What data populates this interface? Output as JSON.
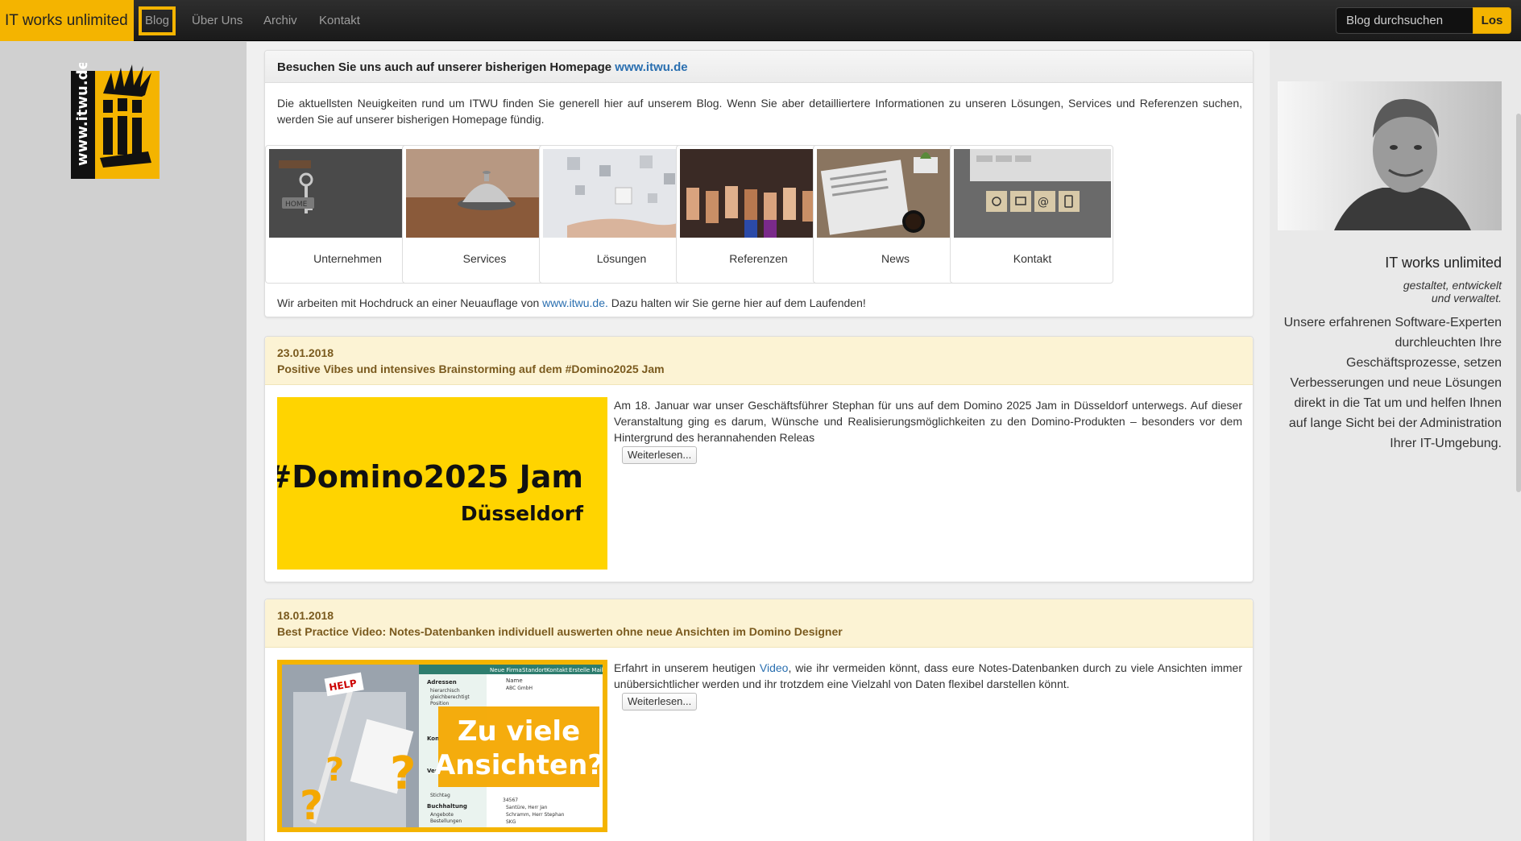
{
  "navbar": {
    "brand": "IT works unlimited",
    "items": [
      {
        "label": "Blog",
        "active": true
      },
      {
        "label": "Über Uns"
      },
      {
        "label": "Archiv"
      },
      {
        "label": "Kontakt"
      }
    ],
    "search_placeholder": "Blog durchsuchen",
    "search_button": "Los"
  },
  "logo": {
    "text": "www.itwu.de",
    "icon": "itwu-logo"
  },
  "intro": {
    "heading_prefix": "Besuchen Sie uns auch auf unserer bisherigen Homepage",
    "heading_link": "www.itwu.de",
    "text": "Die aktuellsten Neuigkeiten rund um ITWU finden Sie generell hier auf unserem Blog. Wenn Sie aber detailliertere Informationen zu unseren Lösungen, Services und Referenzen suchen, werden Sie auf unserer bisherigen Homepage fündig.",
    "tiles": [
      {
        "label": "Unternehmen",
        "icon": "home-key-image"
      },
      {
        "label": "Services",
        "icon": "service-bell-image"
      },
      {
        "label": "Lösungen",
        "icon": "puzzle-hand-image"
      },
      {
        "label": "Referenzen",
        "icon": "thumbs-up-image"
      },
      {
        "label": "News",
        "icon": "newspaper-image"
      },
      {
        "label": "Kontakt",
        "icon": "contact-blocks-image"
      }
    ],
    "footer_prefix": "Wir arbeiten mit Hochdruck an einer Neuauflage von",
    "footer_link": "www.itwu.de.",
    "footer_suffix": "Dazu halten wir Sie gerne hier auf dem Laufenden!"
  },
  "posts": [
    {
      "date": "23.01.2018",
      "title": "Positive Vibes und intensives Brainstorming auf dem #Domino2025 Jam",
      "image_title": "#Domino2025 Jam",
      "image_subtitle": "Düsseldorf",
      "text": "Am 18. Januar war unser Geschäftsführer Stephan für uns auf dem Domino 2025 Jam in Düsseldorf unterwegs. Auf dieser Veranstaltung ging es darum, Wünsche und Realisierungsmöglichkeiten zu den Domino-Produkten – besonders vor dem Hintergrund des herannahenden Releas",
      "more": "Weiterlesen..."
    },
    {
      "date": "18.01.2018",
      "title": "Best Practice Video: Notes-Datenbanken individuell auswerten ohne neue Ansichten im Domino Designer",
      "image_title_line1": "Zu viele",
      "image_title_line2": "Ansichten?",
      "image_ui": {
        "buttons": [
          "Neue Firma",
          "Standort",
          "Kontakt",
          "Erstelle Mail"
        ],
        "column_header": "Name",
        "first_row": "ABC GmbH",
        "nav_items": [
          "Adressen",
          "hierarchisch",
          "gleichberechtigt",
          "Position",
          "Kon",
          "Ver",
          "Stichtag",
          "Buchhaltung",
          "Angebote",
          "Bestellungen"
        ],
        "rows": [
          "34567",
          "Santüre, Herr Jan",
          "Schramm, Herr Stephan",
          "SKG"
        ],
        "sign": "HELP"
      },
      "text_prefix": "Erfahrt in unserem heutigen",
      "text_link": "Video",
      "text_suffix": ", wie ihr vermeiden könnt, dass eure Notes-Datenbanken durch zu viele Ansichten immer unübersichtlicher werden und ihr trotzdem eine Vielzahl von Daten flexibel darstellen könnt.",
      "more": "Weiterlesen..."
    }
  ],
  "sidebar": {
    "title": "IT works unlimited",
    "subtitle_line1": "gestaltet, entwickelt",
    "subtitle_line2": "und verwaltet.",
    "text": "Unsere erfahrenen Software-Experten durchleuchten Ihre Geschäftsprozesse, setzen Verbesserungen und neue Lösungen direkt in die Tat um und helfen Ihnen auf lange Sicht bei der Administration Ihrer IT-Umgebung."
  },
  "colors": {
    "accent": "#f4b400",
    "navbar": "#222222",
    "post_header": "#fcf3d4",
    "link": "#2a6fb0"
  }
}
